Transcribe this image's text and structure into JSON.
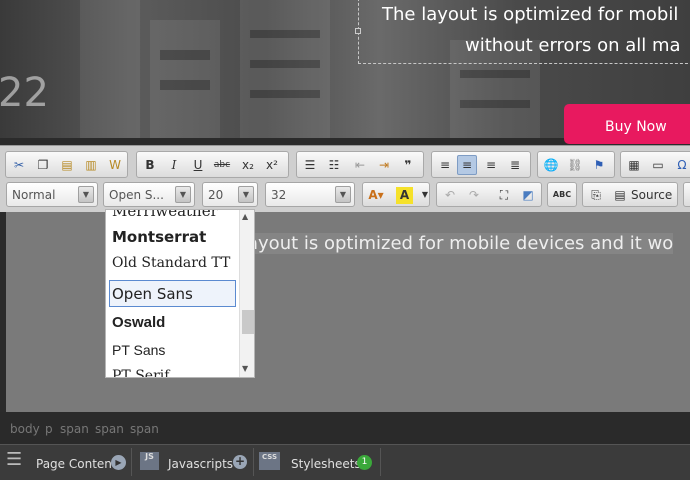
{
  "hero": {
    "number": "22",
    "line1": "The layout is optimized for mobil",
    "line2": "without errors on all ma",
    "buy_button": "Buy Now"
  },
  "toolbar": {
    "format_combo": "Normal",
    "font_combo": "Open S...",
    "size_combo": "20",
    "lineheight_combo": "32",
    "source_label": "Source"
  },
  "editor": {
    "text": "ayout is optimized for mobile devices and it wo"
  },
  "font_dropdown": {
    "items": [
      "Merriweather",
      "Montserrat",
      "Old Standard TT",
      "Open Sans",
      "Oswald",
      "PT Sans",
      "PT Serif"
    ],
    "selected": "Open Sans"
  },
  "pathbar": {
    "items": [
      "body",
      "p",
      "span",
      "span",
      "span"
    ]
  },
  "bottombar": {
    "page_content": "Page Content",
    "javascripts": "Javascripts",
    "stylesheets": "Stylesheets",
    "stylesheets_count": "1",
    "js_badge": "JS",
    "css_badge": "CSS"
  },
  "colors": {
    "accent": "#e8195f",
    "selection": "#5b8ad0",
    "badge_green": "#3aa83a"
  }
}
